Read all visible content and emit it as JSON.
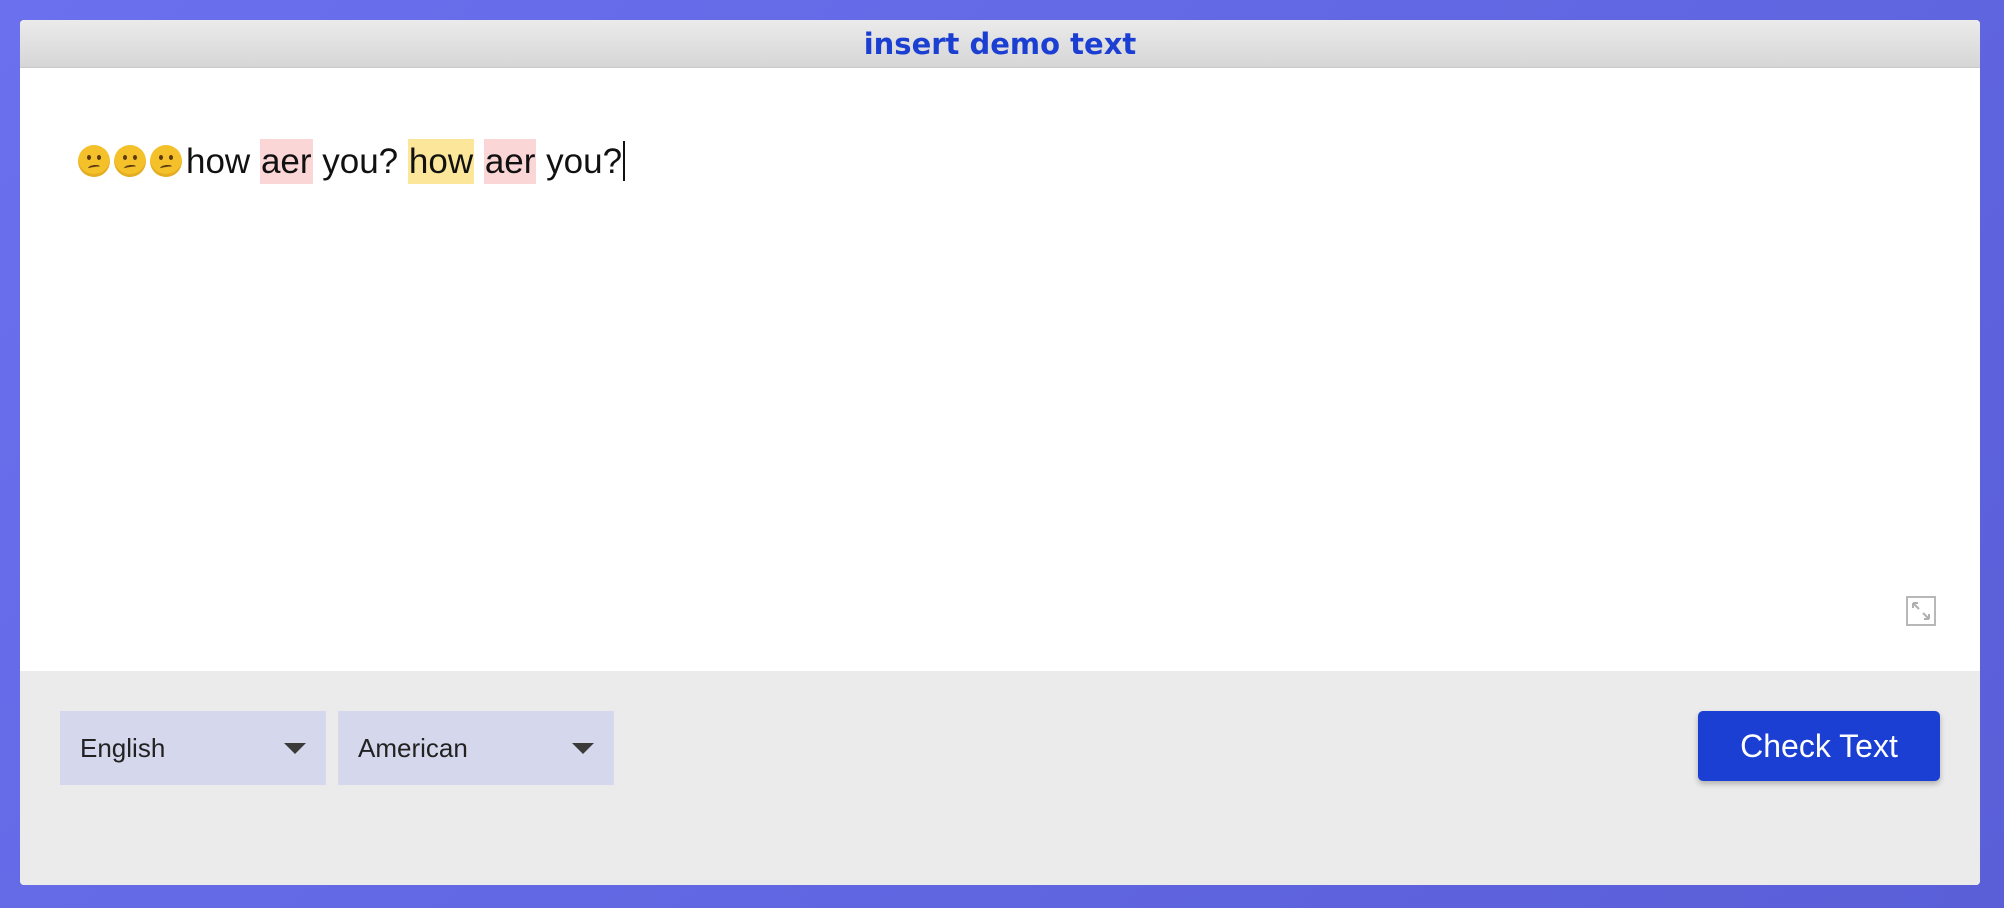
{
  "header": {
    "link_text": "insert demo text"
  },
  "editor": {
    "emoji_count": 3,
    "emoji_icon": "confused-face",
    "segments": [
      {
        "text": "how ",
        "highlight": "none"
      },
      {
        "text": "aer",
        "highlight": "spelling"
      },
      {
        "text": " you? ",
        "highlight": "none"
      },
      {
        "text": "how",
        "highlight": "style"
      },
      {
        "text": " ",
        "highlight": "none"
      },
      {
        "text": "aer",
        "highlight": "spelling"
      },
      {
        "text": " you?",
        "highlight": "none"
      }
    ],
    "highlight_colors": {
      "spelling": "#fbd6d6",
      "style": "#fbe69a"
    },
    "expand_icon": "expand-icon"
  },
  "footer": {
    "language_select": {
      "value": "English"
    },
    "variant_select": {
      "value": "American"
    },
    "check_button_label": "Check Text"
  },
  "colors": {
    "accent": "#1b3fd2",
    "background": "#6a70ee"
  }
}
